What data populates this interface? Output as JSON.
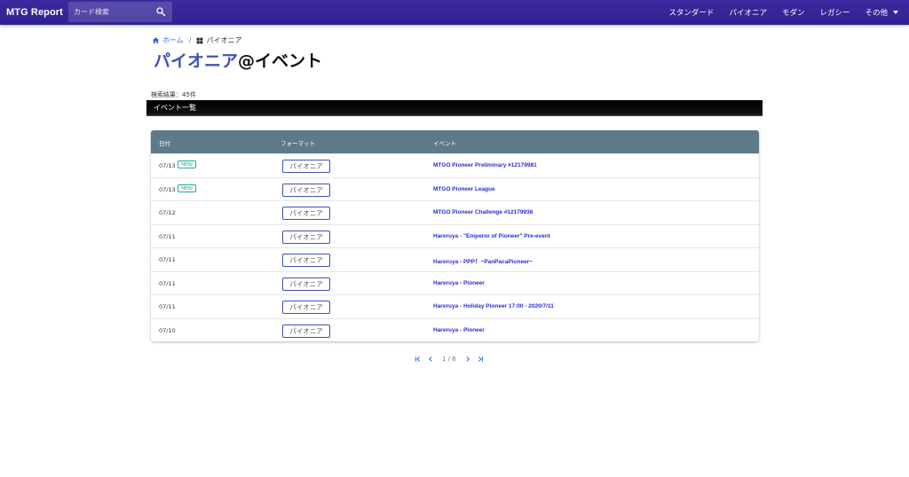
{
  "header": {
    "brand": "MTG Report",
    "search_placeholder": "カード検索",
    "nav": [
      "スタンダード",
      "パイオニア",
      "モダン",
      "レガシー",
      "その他"
    ]
  },
  "breadcrumb": {
    "home": "ホーム",
    "separator": "/",
    "current": "パイオニア"
  },
  "title": {
    "accent": "パイオニア",
    "rest": "@イベント"
  },
  "result_count": "検索結果：45件",
  "section_title": "イベント一覧",
  "table": {
    "columns": [
      "日付",
      "フォーマット",
      "イベント"
    ],
    "rows": [
      {
        "date": "07/13",
        "badge": "NEW",
        "format": "パイオニア",
        "event": "MTGO Pioneer Preliminary #12179981"
      },
      {
        "date": "07/13",
        "badge": "NEW",
        "format": "パイオニア",
        "event": "MTGO Pioneer League"
      },
      {
        "date": "07/12",
        "badge": "",
        "format": "パイオニア",
        "event": "MTGO Pioneer Challenge #12179936"
      },
      {
        "date": "07/11",
        "badge": "",
        "format": "パイオニア",
        "event": "Hareruya - \"Emperor of Pioneer\" Pre-event"
      },
      {
        "date": "07/11",
        "badge": "",
        "format": "パイオニア",
        "event": "Hareruya - PPP！~PanPacaPioneer~"
      },
      {
        "date": "07/11",
        "badge": "",
        "format": "パイオニア",
        "event": "Hareruya - Pioneer"
      },
      {
        "date": "07/11",
        "badge": "",
        "format": "パイオニア",
        "event": "Hareruya - Holiday Pioneer 17:00 - 2020/7/11"
      },
      {
        "date": "07/10",
        "badge": "",
        "format": "パイオニア",
        "event": "Hareruya - Pioneer"
      }
    ]
  },
  "pagination": {
    "label": "1 / 6"
  },
  "colors": {
    "appbar": "#3b2a9e",
    "accent": "#3f51b5",
    "table_header": "#5f7a87",
    "link": "#2b2bd6",
    "badge": "#26a69a"
  }
}
